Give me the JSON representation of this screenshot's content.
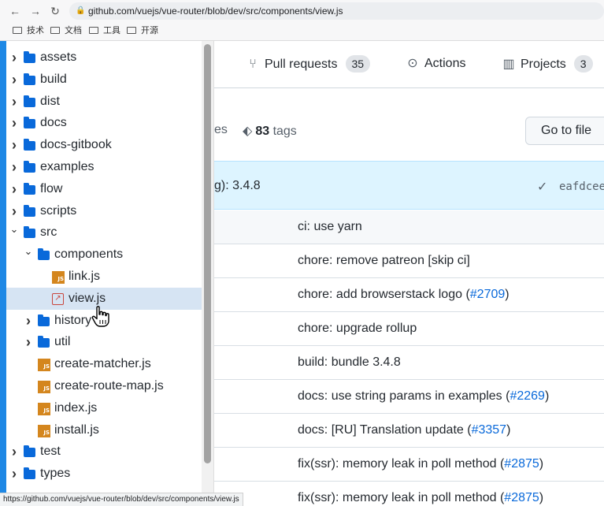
{
  "browser": {
    "url": "github.com/vuejs/vue-router/blob/dev/src/components/view.js",
    "bookmarks": [
      "技术",
      "文档",
      "工具",
      "开源"
    ],
    "status_url": "https://github.com/vuejs/vue-router/blob/dev/src/components/view.js"
  },
  "tree": [
    {
      "label": "assets",
      "type": "folder",
      "chevron": "›"
    },
    {
      "label": "build",
      "type": "folder",
      "chevron": "›"
    },
    {
      "label": "dist",
      "type": "folder",
      "chevron": "›"
    },
    {
      "label": "docs",
      "type": "folder",
      "chevron": "›"
    },
    {
      "label": "docs-gitbook",
      "type": "folder",
      "chevron": "›"
    },
    {
      "label": "examples",
      "type": "folder",
      "chevron": "›"
    },
    {
      "label": "flow",
      "type": "folder",
      "chevron": "›"
    },
    {
      "label": "scripts",
      "type": "folder",
      "chevron": "›"
    },
    {
      "label": "src",
      "type": "folder",
      "chevron": "⌄"
    },
    {
      "label": "components",
      "type": "folder",
      "chevron": "⌄"
    },
    {
      "label": "link.js",
      "type": "js"
    },
    {
      "label": "view.js",
      "type": "external",
      "selected": true
    },
    {
      "label": "history",
      "type": "folder",
      "chevron": "›"
    },
    {
      "label": "util",
      "type": "folder",
      "chevron": "›"
    },
    {
      "label": "create-matcher.js",
      "type": "js"
    },
    {
      "label": "create-route-map.js",
      "type": "js"
    },
    {
      "label": "index.js",
      "type": "js"
    },
    {
      "label": "install.js",
      "type": "js"
    },
    {
      "label": "test",
      "type": "folder",
      "chevron": "›"
    },
    {
      "label": "types",
      "type": "folder",
      "chevron": "›"
    }
  ],
  "tabs": {
    "pull_requests": {
      "label": "Pull requests",
      "count": "35"
    },
    "actions": {
      "label": "Actions"
    },
    "projects": {
      "label": "Projects",
      "count": "3"
    }
  },
  "repo": {
    "branches_fragment": "es",
    "tags_count": "83",
    "tags_label": "tags",
    "goto_file": "Go to file"
  },
  "latest_commit": {
    "message_fragment": "g): 3.4.8",
    "sha": "eafdcee"
  },
  "commits": [
    {
      "text": "ci: use yarn",
      "pr": "",
      "suffix": ""
    },
    {
      "text": "chore: remove patreon [skip ci]",
      "pr": "",
      "suffix": ""
    },
    {
      "text": "chore: add browserstack logo (",
      "pr": "#2709",
      "suffix": ")"
    },
    {
      "text": "chore: upgrade rollup",
      "pr": "",
      "suffix": ""
    },
    {
      "text": "build: bundle 3.4.8",
      "pr": "",
      "suffix": ""
    },
    {
      "text": "docs: use string params in examples (",
      "pr": "#2269",
      "suffix": ")"
    },
    {
      "text": "docs: [RU] Translation update (",
      "pr": "#3357",
      "suffix": ")"
    },
    {
      "text": "fix(ssr): memory leak in poll method (",
      "pr": "#2875",
      "suffix": ")"
    },
    {
      "text": "fix(ssr): memory leak in poll method (",
      "pr": "#2875",
      "suffix": ")"
    }
  ],
  "colors": {
    "accent": "#0969da",
    "folder": "#0969da",
    "js_icon": "#d4861e",
    "selected_row": "#d6e4f3",
    "commit_bar": "#ddf4ff"
  },
  "icons": {
    "back": "back-arrow-icon",
    "forward": "forward-arrow-icon",
    "reload": "reload-icon",
    "lock": "lock-icon",
    "pull_request": "git-pull-request-icon",
    "actions": "play-circle-icon",
    "projects": "project-board-icon",
    "tag": "tag-icon",
    "check": "check-icon",
    "cursor": "hand-pointer-icon"
  }
}
